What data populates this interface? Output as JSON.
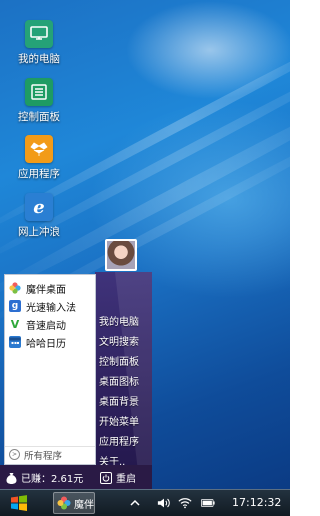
{
  "desktop": {
    "icons": [
      {
        "label": "我的电脑",
        "icon": "my-computer-icon",
        "color": "#25a277"
      },
      {
        "label": "控制面板",
        "icon": "control-panel-icon",
        "color": "#1e9b63"
      },
      {
        "label": "应用程序",
        "icon": "app-programs-icon",
        "color": "#f29b18"
      },
      {
        "label": "网上冲浪",
        "icon": "browser-icon",
        "color": "#2a7fd3"
      }
    ]
  },
  "start_menu": {
    "left_items": [
      {
        "label": "魔伴桌面",
        "icon": "pinwheel-icon"
      },
      {
        "label": "光速输入法",
        "icon": "input-method-icon"
      },
      {
        "label": "音速启动",
        "icon": "launcher-v-icon"
      },
      {
        "label": "哈哈日历",
        "icon": "calendar-icon"
      }
    ],
    "all_programs": "所有程序",
    "right_items": [
      "我的电脑",
      "文明搜索",
      "控制面板",
      "桌面图标",
      "桌面背景",
      "开始菜单",
      "应用程序",
      "关于.."
    ],
    "earned": "已赚：2.61元",
    "restart": "重启"
  },
  "taskbar": {
    "task_label": "魔伴",
    "clock": "17:12:32"
  }
}
